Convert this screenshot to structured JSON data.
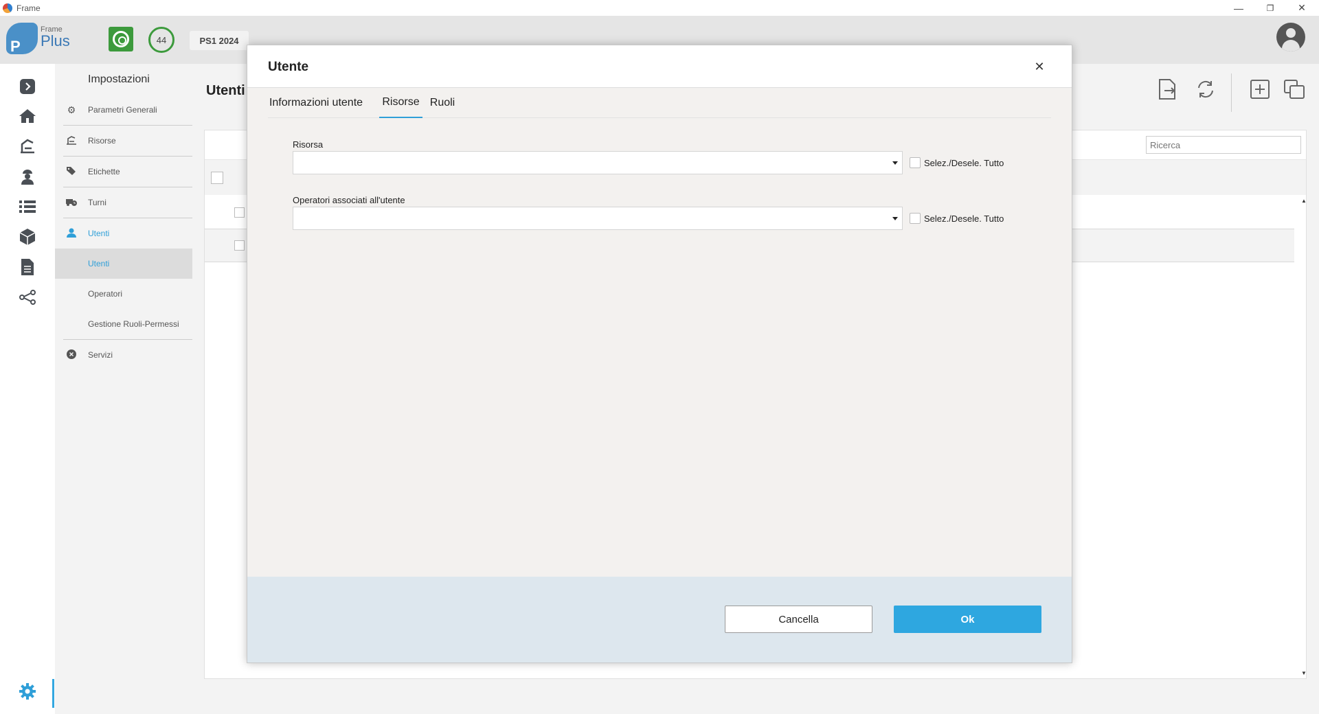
{
  "window": {
    "title": "Frame",
    "controls": {
      "minimize": "—",
      "restore": "❐",
      "close": "✕"
    }
  },
  "header": {
    "logo": {
      "small": "Frame",
      "big": "Plus",
      "letter": "P"
    },
    "counter": "44",
    "plant_tag": "PS1 2024"
  },
  "menu": {
    "title": "Impostazioni",
    "items": [
      {
        "label": "Parametri Generali",
        "icon": "gear-icon"
      },
      {
        "label": "Risorse",
        "icon": "machine-icon"
      },
      {
        "label": "Etichette",
        "icon": "tags-icon"
      },
      {
        "label": "Turni",
        "icon": "truck-clock-icon"
      },
      {
        "label": "Utenti",
        "icon": "user-icon"
      },
      {
        "label": "Utenti"
      },
      {
        "label": "Operatori"
      },
      {
        "label": "Gestione Ruoli-Permessi"
      },
      {
        "label": "Servizi",
        "icon": "close-circle-icon"
      }
    ]
  },
  "main": {
    "title": "Utenti",
    "search_placeholder": "Ricerca"
  },
  "dialog": {
    "title": "Utente",
    "tabs": [
      {
        "label": "Informazioni utente"
      },
      {
        "label": "Risorse"
      },
      {
        "label": "Ruoli"
      }
    ],
    "active_tab": "Risorse",
    "fields": {
      "risorsa_label": "Risorsa",
      "risorsa_value": "",
      "operatori_label": "Operatori associati all'utente",
      "operatori_value": "",
      "select_all_label": "Selez./Desele. Tutto"
    },
    "buttons": {
      "cancel": "Cancella",
      "ok": "Ok"
    },
    "close_glyph": "✕"
  },
  "colors": {
    "accent": "#2ea7e0",
    "header_bg": "#e5e5e5",
    "footer_bg": "#dde7ee",
    "green": "#3c9a3c"
  }
}
